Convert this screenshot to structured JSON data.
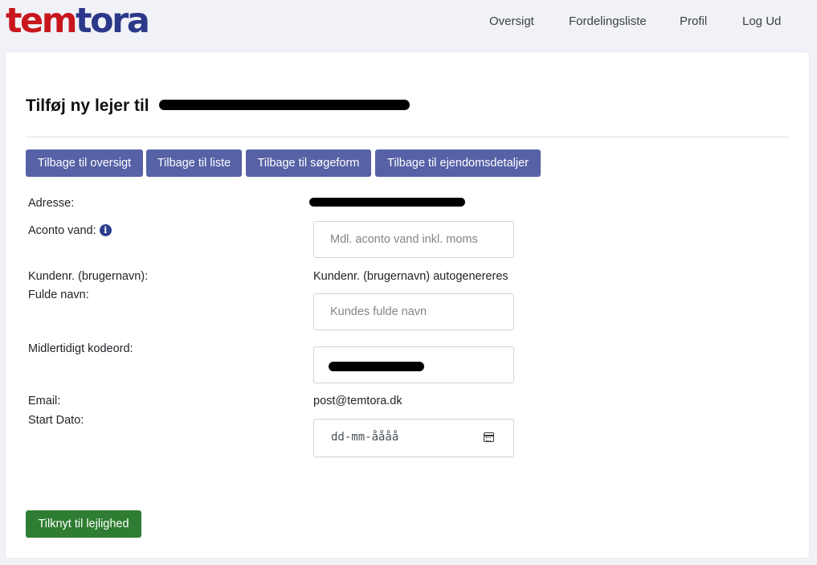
{
  "brand": {
    "part1": "tem",
    "part2": "tora"
  },
  "nav": {
    "overview": "Oversigt",
    "distribution": "Fordelingsliste",
    "profile": "Profil",
    "logout": "Log Ud"
  },
  "page": {
    "title": "Tilføj ny lejer til"
  },
  "buttons": {
    "back_overview": "Tilbage til oversigt",
    "back_list": "Tilbage til liste",
    "back_search": "Tilbage til søgeform",
    "back_property": "Tilbage til ejendomsdetaljer",
    "submit": "Tilknyt til lejlighed"
  },
  "form": {
    "address_label": "Adresse:",
    "aconto_label": "Aconto vand:",
    "aconto_placeholder": "Mdl. aconto vand inkl. moms",
    "customer_label": "Kundenr. (brugernavn):",
    "customer_value": "Kundenr. (brugernavn) autogenereres",
    "fullname_label": "Fulde navn:",
    "fullname_placeholder": "Kundes fulde navn",
    "password_label": "Midlertidigt kodeord:",
    "email_label": "Email:",
    "email_value": "post@temtora.dk",
    "startdate_label": "Start Dato:",
    "startdate_placeholder": "dd-mm-åååå"
  },
  "icons": {
    "info": "info-icon",
    "calendar": "calendar-icon"
  }
}
